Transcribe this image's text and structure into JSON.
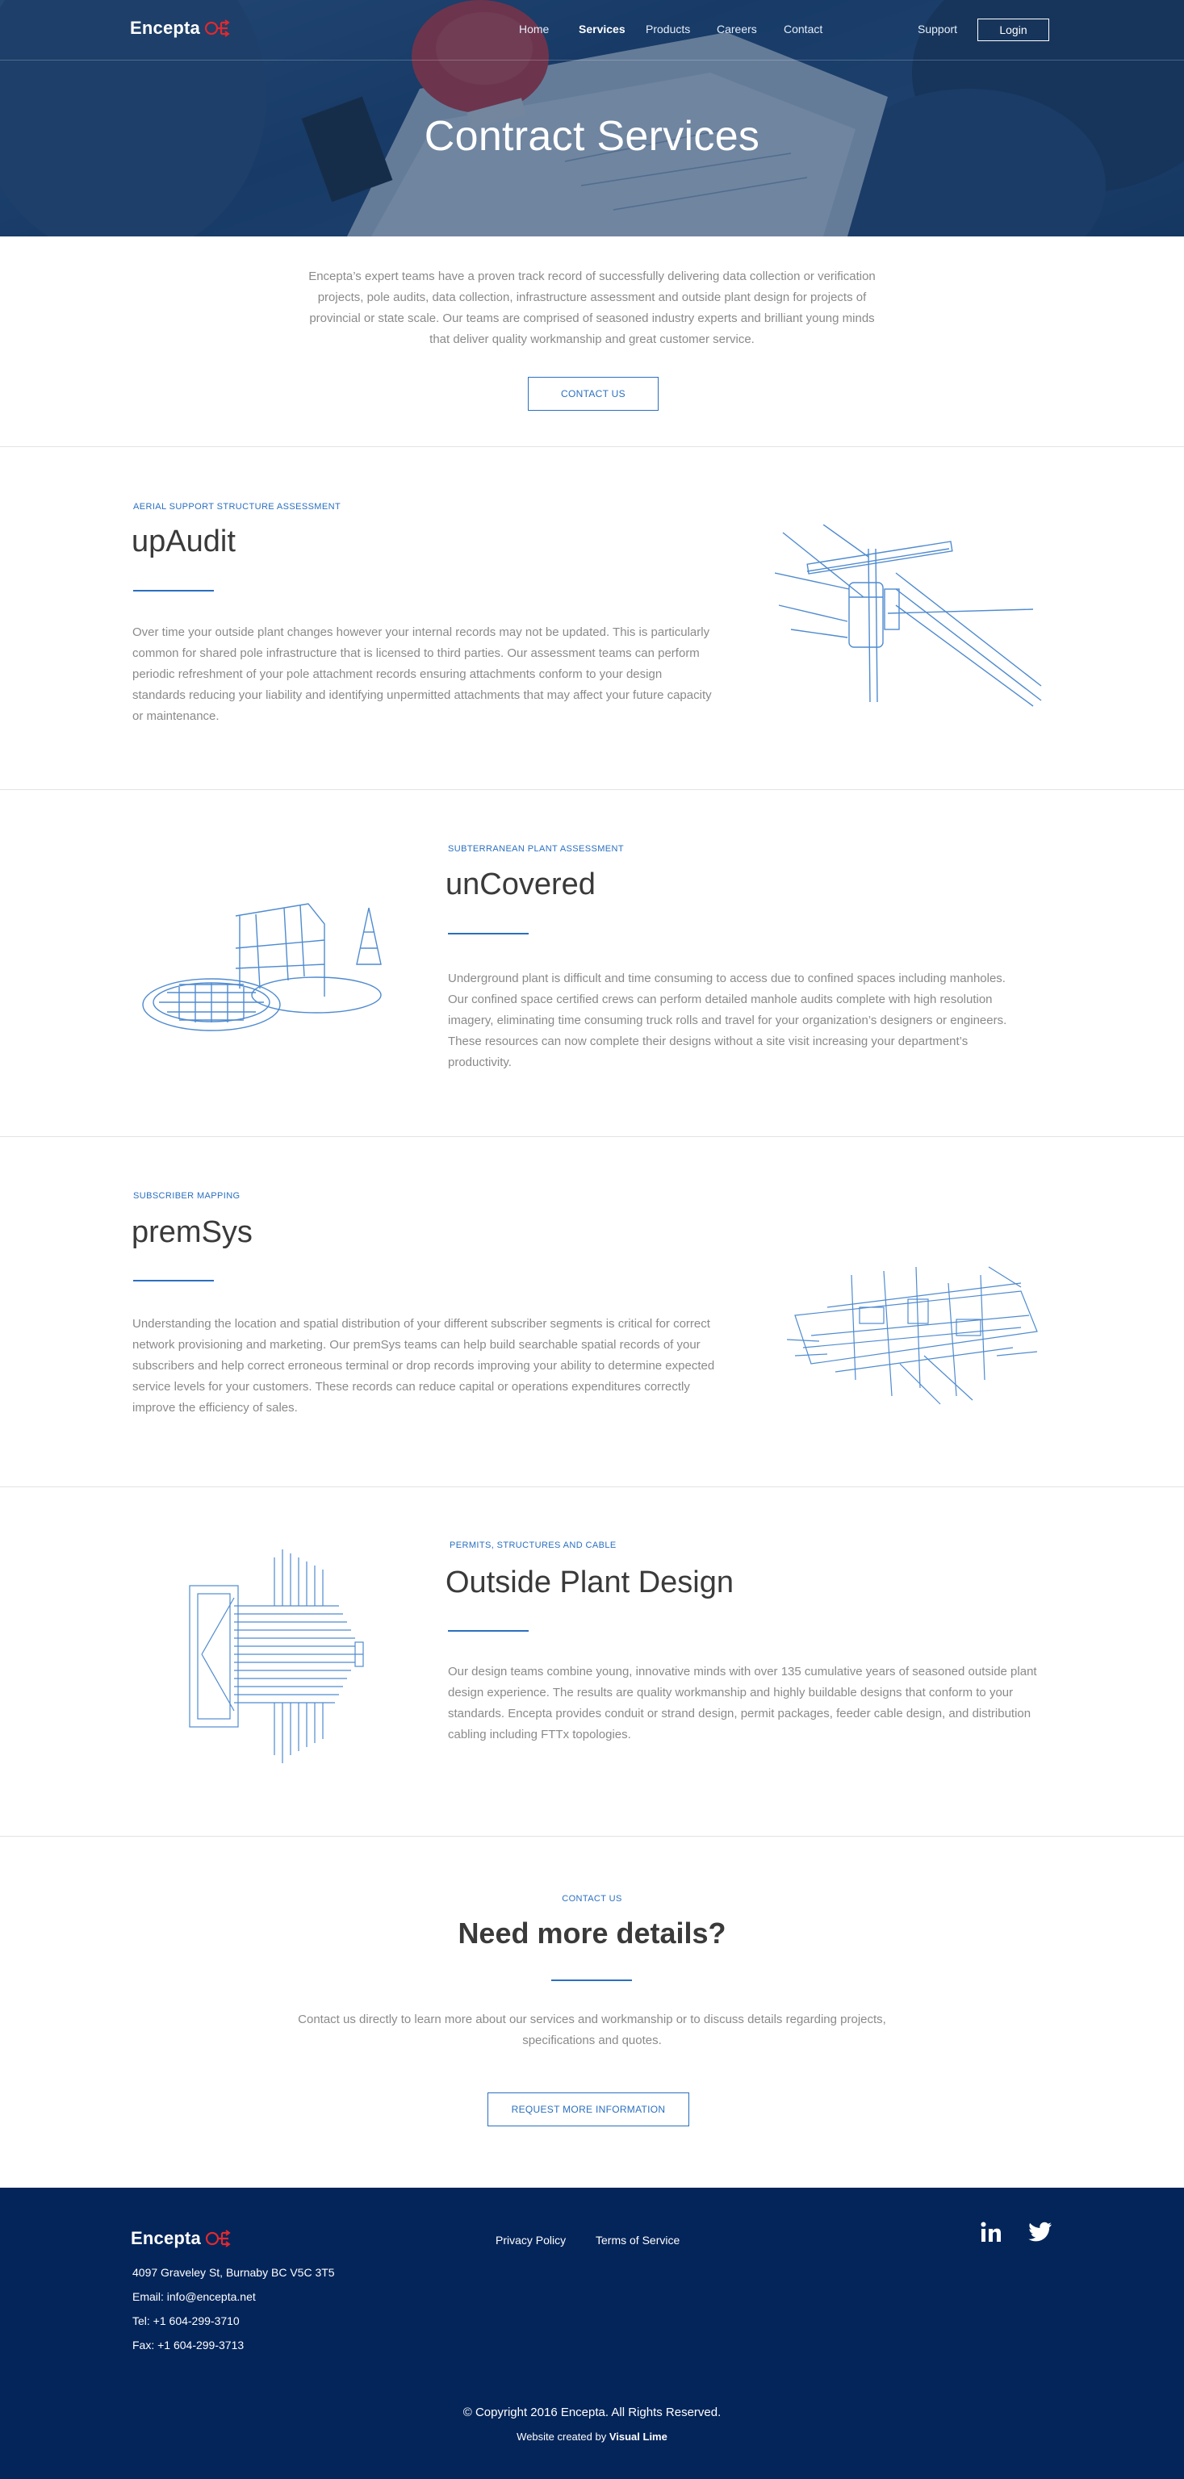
{
  "brand": {
    "name": "Encepta",
    "accent_color": "#2a6fc0",
    "logo_mark_color": "#e0292e",
    "footer_bg": "#04255a"
  },
  "nav": {
    "items": [
      {
        "label": "Home",
        "active": false
      },
      {
        "label": "Services",
        "active": true
      },
      {
        "label": "Products",
        "active": false
      },
      {
        "label": "Careers",
        "active": false
      },
      {
        "label": "Contact",
        "active": false
      }
    ],
    "support_label": "Support",
    "login_label": "Login"
  },
  "hero": {
    "title": "Contract Services"
  },
  "intro": {
    "text": "Encepta’s expert teams have a proven track record of successfully delivering data collection or verification projects, pole audits, data collection, infrastructure assessment and outside plant design for projects of provincial or state scale. Our teams are comprised of seasoned industry experts and brilliant young minds that deliver quality workmanship and great customer service.",
    "button_label": "CONTACT US"
  },
  "services": [
    {
      "eyebrow": "AERIAL SUPPORT STRUCTURE ASSESSMENT",
      "title": "upAudit",
      "description": "Over time your outside plant changes however your internal records may not be updated. This is particularly common for shared pole infrastructure that is licensed to third parties. Our assessment teams can perform periodic refreshment of your pole attachment records ensuring attachments conform to your design standards reducing your liability and identifying unpermitted attachments that may affect your future capacity or maintenance.",
      "illustration": "utility-pole-icon"
    },
    {
      "eyebrow": "SUBTERRANEAN PLANT ASSESSMENT",
      "title": "unCovered",
      "description": "Underground plant is difficult and time consuming to access due to confined spaces including manholes. Our confined space certified crews can perform detailed manhole audits complete with high resolution imagery, eliminating time consuming truck rolls and travel for your organization’s designers or engineers. These resources can now complete their designs without a site visit increasing your department’s productivity.",
      "illustration": "manhole-icon"
    },
    {
      "eyebrow": "SUBSCRIBER MAPPING",
      "title": "premSys",
      "description": "Understanding the location and spatial distribution of your different subscriber segments is critical for correct network provisioning and marketing. Our premSys teams can help build searchable spatial records of your subscribers and help correct erroneous terminal or drop records improving your ability to determine expected service levels for your customers. These records can reduce capital or operations expenditures correctly improve the efficiency of sales.",
      "illustration": "subscriber-map-icon"
    },
    {
      "eyebrow": "PERMITS, STRUCTURES AND CABLE",
      "title": "Outside Plant Design",
      "description": "Our design teams combine young, innovative minds with over 135 cumulative years of seasoned outside plant design experience. The results are quality workmanship and highly buildable designs that conform to your standards. Encepta provides conduit or strand design, permit packages, feeder cable design, and distribution cabling including FTTx topologies.",
      "illustration": "cable-design-icon"
    }
  ],
  "cta": {
    "eyebrow": "CONTACT US",
    "title": "Need more details?",
    "text": "Contact us directly to learn more about our services and workmanship or to discuss details regarding projects, specifications and quotes.",
    "button_label": "REQUEST MORE INFORMATION"
  },
  "footer": {
    "address": "4097 Graveley St, Burnaby BC V5C 3T5",
    "email": "Email: info@encepta.net",
    "tel": "Tel: +1 604-299-3710",
    "fax": "Fax: +1 604-299-3713",
    "links": [
      "Privacy Policy",
      "Terms of Service"
    ],
    "social": [
      "linkedin-icon",
      "twitter-icon"
    ],
    "copyright": "© Copyright 2016 Encepta. All Rights Reserved.",
    "credit_prefix": "Website created by",
    "credit_name": "Visual Lime"
  }
}
